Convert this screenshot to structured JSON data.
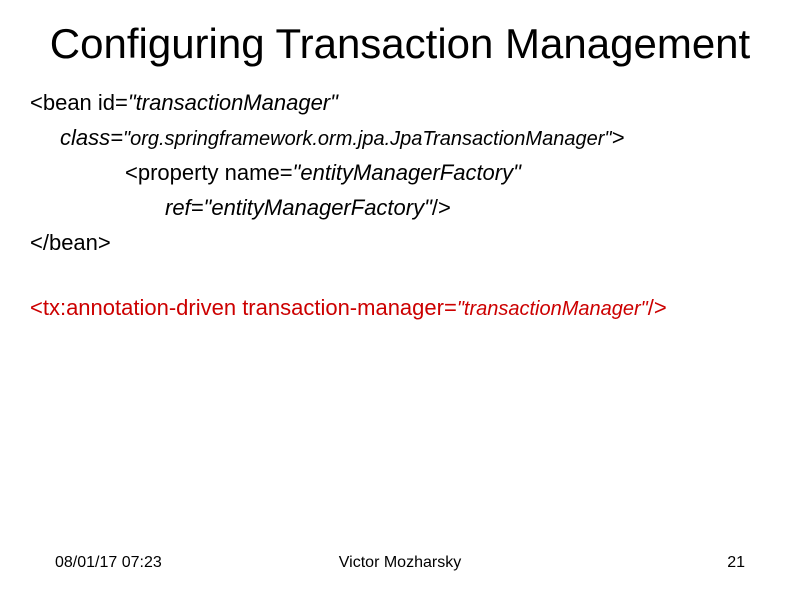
{
  "title": "Configuring Transaction Management",
  "lines": {
    "l1_open": "<bean id=",
    "l1_val": "\"transactionManager\"",
    "l2_attr": "class=",
    "l2_val": "\"org.springframework.orm.jpa.JpaTransactionManager\"",
    "l2_close": ">",
    "l3_open": "<property name=",
    "l3_val": "\"entityManagerFactory\"",
    "l4_attr": "ref=",
    "l4_val": "\"entityManagerFactory\"",
    "l4_close": "/>",
    "l5": "</bean>",
    "l6_open": "<tx:annotation-driven transaction-manager=",
    "l6_val": "\"transactionManager\"",
    "l6_close": "/>"
  },
  "footer": {
    "date": "08/01/17 07:23",
    "author": "Victor Mozharsky",
    "page": "21"
  }
}
